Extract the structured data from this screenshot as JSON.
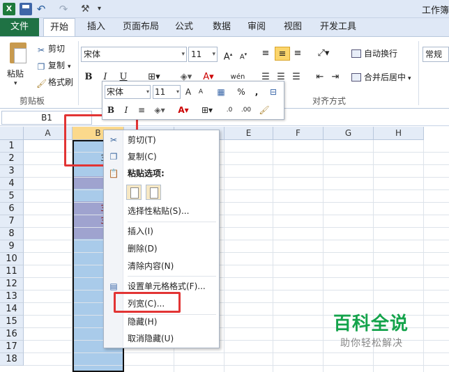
{
  "window": {
    "title": "工作簿"
  },
  "qat": {
    "app_icon": "X",
    "icons": [
      "excel-icon",
      "save-icon",
      "undo-icon",
      "redo-icon",
      "customize-icon"
    ]
  },
  "tabs": {
    "file": "文件",
    "home": "开始",
    "insert": "插入",
    "page_layout": "页面布局",
    "formulas": "公式",
    "data": "数据",
    "review": "审阅",
    "view": "视图",
    "developer": "开发工具"
  },
  "ribbon": {
    "clipboard": {
      "paste": "粘贴",
      "cut": "剪切",
      "copy": "复制",
      "format_painter": "格式刷",
      "group_label": "剪贴板"
    },
    "font": {
      "name": "宋体",
      "size": "11",
      "bold": "B",
      "italic": "I",
      "underline": "U",
      "phonetic": "wén"
    },
    "alignment": {
      "wrap_text": "自动换行",
      "merge_center": "合并后居中",
      "group_label": "对齐方式"
    },
    "number": {
      "format": "常规"
    }
  },
  "formula_bar": {
    "name_box": "B1"
  },
  "grid": {
    "columns": [
      "A",
      "B",
      "C",
      "D",
      "E",
      "F",
      "G",
      "H"
    ],
    "rows": [
      "1",
      "2",
      "3",
      "4",
      "5",
      "6",
      "7",
      "8",
      "9",
      "10",
      "11",
      "12",
      "13",
      "14",
      "15",
      "16",
      "17",
      "18"
    ],
    "b_cell_values": {
      "row2": "3",
      "row6": "3",
      "row7": "3"
    }
  },
  "mini_toolbar": {
    "font": "宋体",
    "size": "11",
    "bold": "B",
    "italic": "I",
    "percent": "%",
    "comma": ","
  },
  "context_menu": {
    "cut": "剪切(T)",
    "copy": "复制(C)",
    "paste_options": "粘贴选项:",
    "paste_special": "选择性粘贴(S)...",
    "insert": "插入(I)",
    "delete": "删除(D)",
    "clear_contents": "清除内容(N)",
    "format_cells": "设置单元格格式(F)...",
    "column_width": "列宽(C)...",
    "hide": "隐藏(H)",
    "unhide": "取消隐藏(U)"
  },
  "watermark": {
    "title": "百科全说",
    "subtitle": "助你轻松解决"
  },
  "colors": {
    "file_tab": "#1f7244",
    "selection": "#a9cbea",
    "highlight_box": "#e23434",
    "watermark_green": "#14a34b"
  }
}
